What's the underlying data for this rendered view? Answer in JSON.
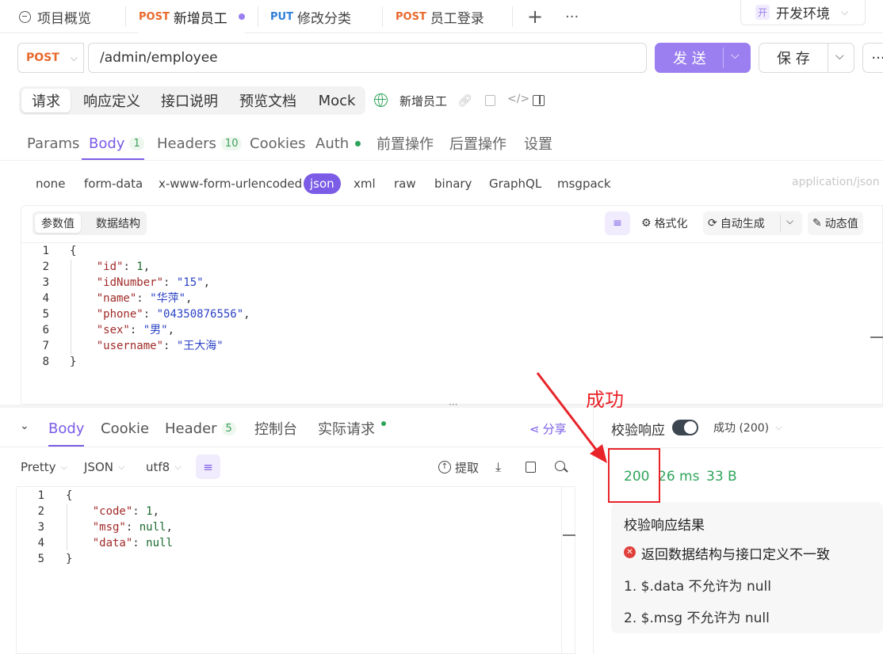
{
  "tabs": {
    "overview": "项目概览",
    "t1_method": "POST",
    "t1_name": "新增员工",
    "t2_method": "PUT",
    "t2_name": "修改分类",
    "t3_method": "POST",
    "t3_name": "员工登录",
    "add": "+",
    "more": "···",
    "env_badge": "开",
    "env": "开发环境"
  },
  "request": {
    "method": "POST",
    "url": "/admin/employee",
    "send": "发 送",
    "save": "保 存",
    "more": "···"
  },
  "seg_tabs": [
    "请求",
    "响应定义",
    "接口说明",
    "预览文档",
    "Mock"
  ],
  "api_name": "新增员工",
  "param_tabs": {
    "params": "Params",
    "body": "Body",
    "body_count": "1",
    "headers": "Headers",
    "headers_count": "10",
    "cookies": "Cookies",
    "auth": "Auth",
    "pre": "前置操作",
    "post": "后置操作",
    "settings": "设置"
  },
  "body_types": [
    "none",
    "form-data",
    "x-www-form-urlencoded",
    "json",
    "xml",
    "raw",
    "binary",
    "GraphQL",
    "msgpack"
  ],
  "content_type": "application/json",
  "editor": {
    "chip_value": "参数值",
    "chip_schema": "数据结构",
    "format": "格式化",
    "auto_gen": "自动生成",
    "dynamic": "动态值"
  },
  "request_body": {
    "line_numbers": [
      "1",
      "2",
      "3",
      "4",
      "5",
      "6",
      "7",
      "8"
    ],
    "open": "{",
    "fields": [
      {
        "key": "\"id\"",
        "value": "1",
        "type": "n",
        "comma": ","
      },
      {
        "key": "\"idNumber\"",
        "value": "\"15\"",
        "type": "s",
        "comma": ","
      },
      {
        "key": "\"name\"",
        "value": "\"华萍\"",
        "type": "s",
        "comma": ","
      },
      {
        "key": "\"phone\"",
        "value": "\"04350876556\"",
        "type": "s",
        "comma": ","
      },
      {
        "key": "\"sex\"",
        "value": "\"男\"",
        "type": "s",
        "comma": ","
      },
      {
        "key": "\"username\"",
        "value": "\"王大海\"",
        "type": "s",
        "comma": ""
      }
    ],
    "close": "}"
  },
  "response_tabs": {
    "body": "Body",
    "cookie": "Cookie",
    "header": "Header",
    "header_count": "5",
    "console": "控制台",
    "actual": "实际请求",
    "share": "分享"
  },
  "response_bar": {
    "pretty": "Pretty",
    "json": "JSON",
    "encoding": "utf8",
    "extract": "提取"
  },
  "response_body": {
    "line_numbers": [
      "1",
      "2",
      "3",
      "4",
      "5"
    ],
    "open": "{",
    "fields": [
      {
        "key": "\"code\"",
        "value": "1",
        "type": "n",
        "comma": ","
      },
      {
        "key": "\"msg\"",
        "value": "null",
        "type": "n",
        "comma": ","
      },
      {
        "key": "\"data\"",
        "value": "null",
        "type": "n",
        "comma": ""
      }
    ],
    "close": "}"
  },
  "validation": {
    "label": "校验响应",
    "status_select": "成功 (200)",
    "status_code": "200",
    "time": "26 ms",
    "size": "33 B",
    "result_title": "校验响应结果",
    "error": "返回数据结构与接口定义不一致",
    "items": [
      "1. $.data 不允许为 null",
      "2. $.msg 不允许为 null"
    ]
  },
  "annotation": "成功",
  "colors": {
    "accent": "#7b5ce6",
    "post": "#e8692c",
    "put": "#2f7ed8",
    "success": "#2ea45a",
    "annotation": "#e8242a"
  }
}
